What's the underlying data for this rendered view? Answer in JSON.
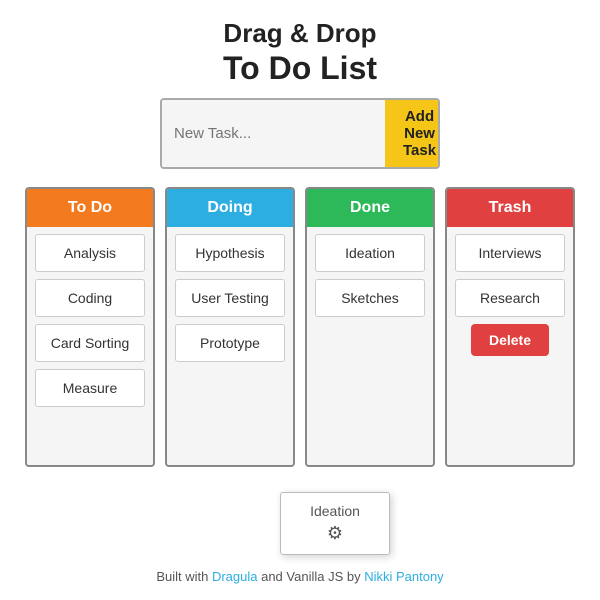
{
  "header": {
    "line1": "Drag & Drop",
    "line2": "To Do List"
  },
  "input": {
    "placeholder": "New Task...",
    "button_label": "Add New Task"
  },
  "columns": [
    {
      "id": "todo",
      "label": "To Do",
      "color_class": "col-todo",
      "cards": [
        "Analysis",
        "Coding",
        "Card Sorting",
        "Measure"
      ]
    },
    {
      "id": "doing",
      "label": "Doing",
      "color_class": "col-doing",
      "cards": [
        "Hypothesis",
        "User Testing",
        "Prototype"
      ]
    },
    {
      "id": "done",
      "label": "Done",
      "color_class": "col-done",
      "cards": [
        "Ideation",
        "Sketches"
      ]
    },
    {
      "id": "trash",
      "label": "Trash",
      "color_class": "col-trash",
      "cards": [
        "Interviews",
        "Research"
      ],
      "has_delete": true
    }
  ],
  "ghost": {
    "label": "Ideation"
  },
  "footer": {
    "text_before": "Built with ",
    "link1_label": "Dragula",
    "link1_href": "#",
    "text_middle": " and Vanilla JS by ",
    "link2_label": "Nikki Pantony",
    "link2_href": "#"
  }
}
